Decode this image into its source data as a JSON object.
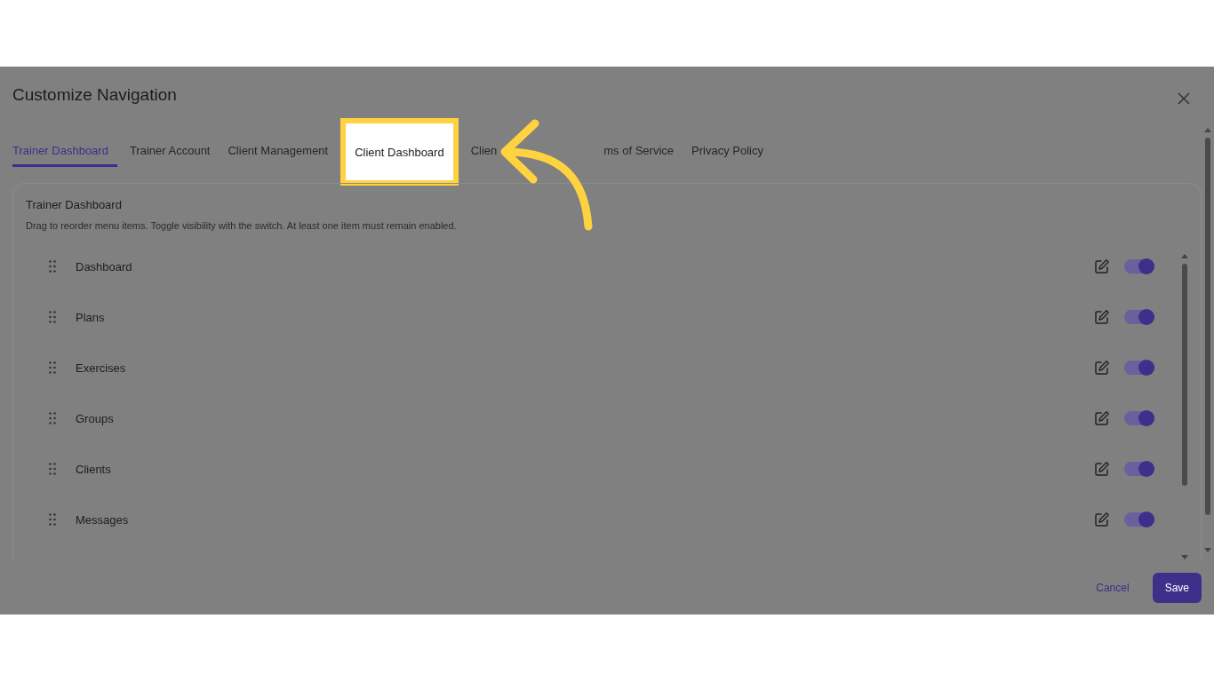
{
  "dialog": {
    "title": "Customize Navigation"
  },
  "tabs": [
    {
      "label": "Trainer Dashboard",
      "selected": true,
      "highlighted": false
    },
    {
      "label": "Trainer Account",
      "selected": false,
      "highlighted": false
    },
    {
      "label": "Client Management",
      "selected": false,
      "highlighted": false
    },
    {
      "label": "Client Dashboard",
      "selected": false,
      "highlighted": true
    },
    {
      "label": "Clien",
      "selected": false,
      "highlighted": false
    },
    {
      "label": "ms of Service",
      "selected": false,
      "highlighted": false
    },
    {
      "label": "Privacy Policy",
      "selected": false,
      "highlighted": false
    }
  ],
  "card": {
    "title": "Trainer Dashboard",
    "description": "Drag to reorder menu items. Toggle visibility with the switch. At least one item must remain enabled."
  },
  "items": [
    {
      "label": "Dashboard",
      "on": true
    },
    {
      "label": "Plans",
      "on": true
    },
    {
      "label": "Exercises",
      "on": true
    },
    {
      "label": "Groups",
      "on": true
    },
    {
      "label": "Clients",
      "on": true
    },
    {
      "label": "Messages",
      "on": true
    }
  ],
  "buttons": {
    "cancel": "Cancel",
    "save": "Save"
  }
}
